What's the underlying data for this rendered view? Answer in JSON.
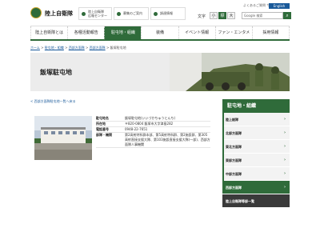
{
  "header": {
    "logo_text": "陸上自衛隊",
    "box1_line1": "陸上自衛隊",
    "box1_line2": "広報センター",
    "box2": "募集のご案内",
    "box3": "調達情報",
    "small_links": "よくあるご質問  サイトマップ",
    "lang": "English",
    "size_label": "文字",
    "size_sizes": [
      "小",
      "標",
      "大"
    ],
    "search_placeholder": "Google 検索",
    "search_icon": "search-icon"
  },
  "nav": {
    "items": [
      {
        "label": "陸上自衛隊とは"
      },
      {
        "label": "各種活動報告"
      },
      {
        "label": "駐屯地・組織"
      },
      {
        "label": "装備"
      },
      {
        "label": "イベント情報"
      },
      {
        "label": "ファン・エンタメ"
      },
      {
        "label": "採用情報"
      }
    ],
    "active_index": 2
  },
  "breadcrumb": {
    "items": [
      "ホーム",
      "駐屯地・組織",
      "西部方面隊",
      "西部方面隊",
      "飯塚駐屯地"
    ],
    "separator": ">"
  },
  "banner": {
    "title": "飯塚駐屯地"
  },
  "backlink": "< 西部方面隊駐屯地一覧へ戻る",
  "info": {
    "rows": [
      {
        "key": "駐屯地名",
        "value": "飯塚駐屯地(いいづかちゅうとんち)"
      },
      {
        "key": "所在地",
        "value": "〒820-0804 飯塚市大字津島282"
      },
      {
        "key": "電話番号",
        "value": "0948-22-7651"
      },
      {
        "key": "部隊・機関",
        "value": "第2高射特科群本部、第5高射特科群、第2施設群、第305高射直接支援大隊、第103施設直接支援大隊(一部)、西部方面隊人事機関"
      }
    ]
  },
  "side": {
    "title": "駐屯地・組織",
    "items": [
      {
        "label": "陸上総隊"
      },
      {
        "label": "北部方面隊"
      },
      {
        "label": "東北方面隊"
      },
      {
        "label": "東部方面隊"
      },
      {
        "label": "中部方面隊"
      },
      {
        "label": "西部方面隊"
      },
      {
        "label": "陸上自衛隊等部一覧"
      }
    ],
    "active_index": 5,
    "arrow": "chevron-right-icon"
  },
  "colors": {
    "accent": "#2f6b3a",
    "link": "#1a5a9a"
  }
}
